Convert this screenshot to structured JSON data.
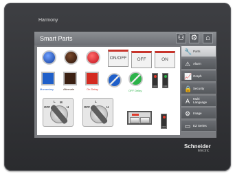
{
  "device": {
    "brand_label": "Harmony",
    "logo_line1": "Schneider",
    "logo_line2": "Electric"
  },
  "screen": {
    "title": "Smart Parts",
    "title_icons": [
      "network-icon",
      "gear-icon",
      "home-icon"
    ]
  },
  "parts": {
    "labels": {
      "momentary": "Momentary",
      "alternate": "Alternate",
      "on_delay": "On Delay",
      "off_delay": "OFF Delay"
    },
    "switches": {
      "on_off": "ON/OFF",
      "off": "OFF",
      "on": "ON"
    },
    "toggle_label": "OFF",
    "selector1": {
      "off": "OFF",
      "l": "L",
      "m": "M",
      "h": "H"
    },
    "selector2": {
      "off": "OFF",
      "l": "L",
      "h": "H"
    }
  },
  "nav": {
    "items": [
      {
        "label": "Parts",
        "icon": "wrench-icon"
      },
      {
        "label": "Alarm",
        "icon": "warning-icon"
      },
      {
        "label": "Graph",
        "icon": "graph-icon"
      },
      {
        "label": "Security",
        "icon": "lock-icon"
      },
      {
        "label": "Multi",
        "label2": "Language",
        "icon": "language-icon"
      },
      {
        "label": "Image",
        "icon": "camera-icon"
      },
      {
        "label": "EZ Series",
        "icon": "screen-icon"
      }
    ],
    "active_index": 0
  },
  "colors": {
    "accent_red": "#c8352c",
    "blue": "#1f5fc9",
    "green": "#2db34a"
  }
}
